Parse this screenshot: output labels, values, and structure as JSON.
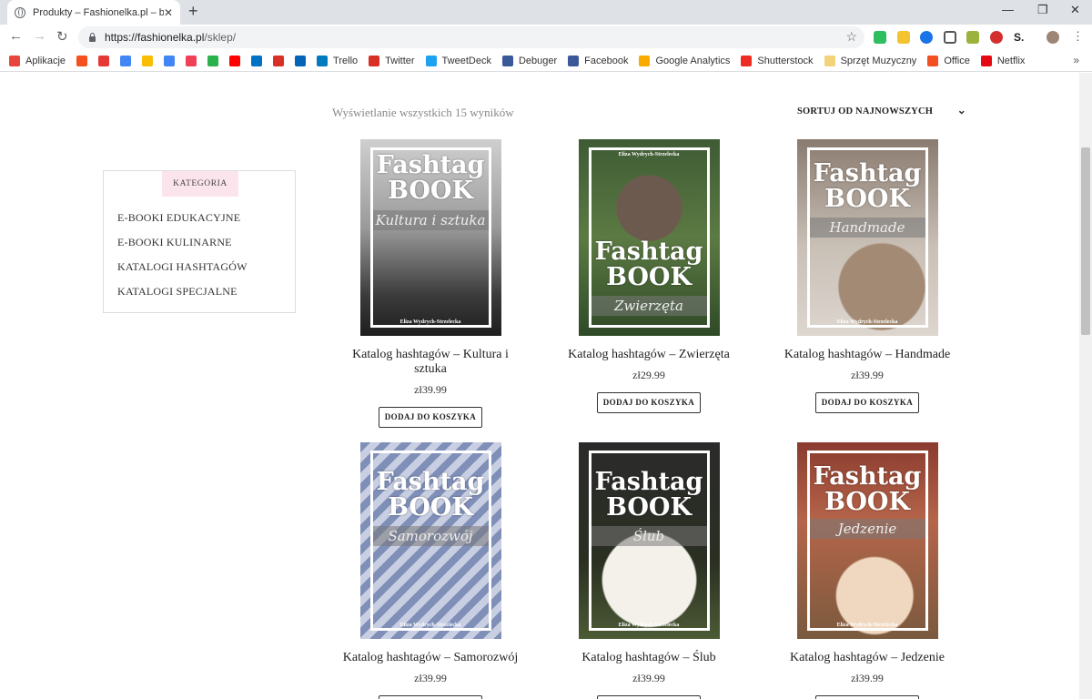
{
  "browser": {
    "tab_title": "Produkty – Fashionelka.pl – blog",
    "url_host": "https://fashionelka.pl",
    "url_path": "/sklep/",
    "bookmarks": [
      {
        "label": "Aplikacje",
        "icon": "apps-icon",
        "color": "#e8453c"
      },
      {
        "label": "",
        "icon": "music-icon",
        "color": "#f4511e"
      },
      {
        "label": "",
        "icon": "play-icon",
        "color": "#e53935"
      },
      {
        "label": "",
        "icon": "calendar-icon",
        "color": "#4285f4"
      },
      {
        "label": "",
        "icon": "keep-icon",
        "color": "#fbbc04"
      },
      {
        "label": "",
        "icon": "docs-icon",
        "color": "#4285f4"
      },
      {
        "label": "",
        "icon": "pocket-icon",
        "color": "#ef4056"
      },
      {
        "label": "",
        "icon": "feedly-icon",
        "color": "#2bb24c"
      },
      {
        "label": "",
        "icon": "youtube-icon",
        "color": "#ff0000"
      },
      {
        "label": "",
        "icon": "outlook-icon",
        "color": "#0072c6"
      },
      {
        "label": "",
        "icon": "gmail-icon",
        "color": "#d93025"
      },
      {
        "label": "",
        "icon": "onedrive-icon",
        "color": "#0364b8"
      },
      {
        "label": "Trello",
        "icon": "trello-icon",
        "color": "#0079bf"
      },
      {
        "label": "Twitter",
        "icon": "gmail-icon",
        "color": "#d93025"
      },
      {
        "label": "TweetDeck",
        "icon": "tweetdeck-icon",
        "color": "#1da1f2"
      },
      {
        "label": "Debuger",
        "icon": "facebook-icon",
        "color": "#3b5998"
      },
      {
        "label": "Facebook",
        "icon": "facebook-icon",
        "color": "#3b5998"
      },
      {
        "label": "Google Analytics",
        "icon": "analytics-icon",
        "color": "#f9ab00"
      },
      {
        "label": "Shutterstock",
        "icon": "shutterstock-icon",
        "color": "#ee2b24"
      },
      {
        "label": "Sprzęt Muzyczny",
        "icon": "folder-icon",
        "color": "#f2d27a"
      },
      {
        "label": "Office",
        "icon": "office-icon",
        "color": "#f25022"
      },
      {
        "label": "Netflix",
        "icon": "netflix-icon",
        "color": "#e50914"
      }
    ]
  },
  "shop": {
    "result_count": "Wyświetlanie wszystkich 15 wyników",
    "sort_label": "SORTUJ OD NAJNOWSZYCH",
    "sidebar_title": "KATEGORIA",
    "categories": [
      "E-BOOKI EDUKACYJNE",
      "E-BOOKI KULINARNE",
      "KATALOGI HASHTAGÓW",
      "KATALOGI SPECJALNE"
    ],
    "add_to_cart": "DODAJ DO KOSZYKA",
    "cover_title": "Fashtag BOOK",
    "cover_author": "Eliza Wydrych-Strzelecka",
    "products": [
      {
        "title": "Katalog hashtagów – Kultura i sztuka",
        "price": "zł39.99",
        "cover_sub": "Kultura i sztuka"
      },
      {
        "title": "Katalog hashtagów – Zwierzęta",
        "price": "zł29.99",
        "cover_sub": "Zwierzęta"
      },
      {
        "title": "Katalog hashtagów – Handmade",
        "price": "zł39.99",
        "cover_sub": "Handmade"
      },
      {
        "title": "Katalog hashtagów – Samorozwój",
        "price": "zł39.99",
        "cover_sub": "Samorozwój"
      },
      {
        "title": "Katalog hashtagów – Ślub",
        "price": "zł39.99",
        "cover_sub": "Ślub"
      },
      {
        "title": "Katalog hashtagów – Jedzenie",
        "price": "zł39.99",
        "cover_sub": "Jedzenie"
      }
    ]
  }
}
